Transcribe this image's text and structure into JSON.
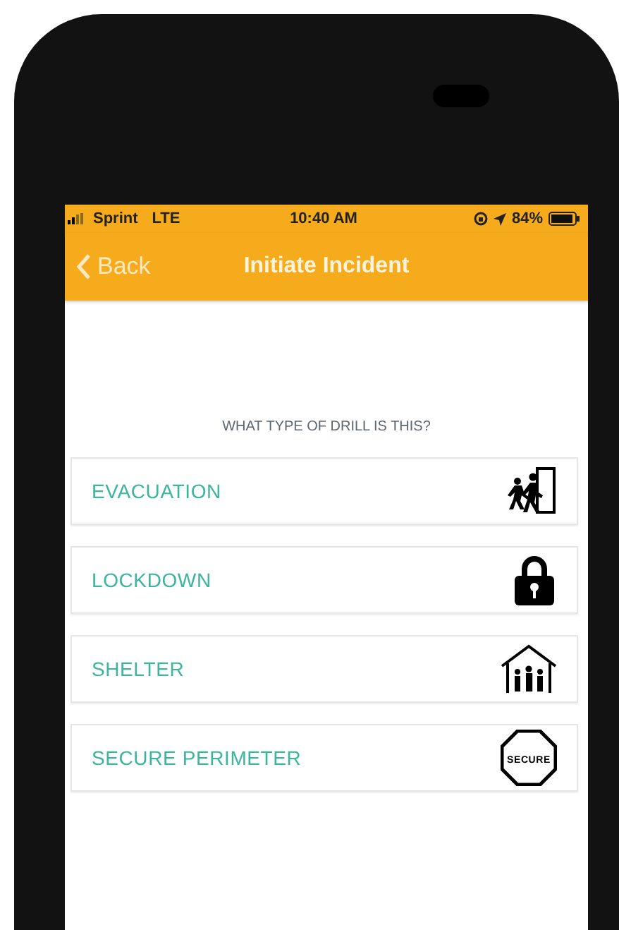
{
  "status_bar": {
    "carrier": "Sprint",
    "network": "LTE",
    "time": "10:40 AM",
    "battery": "84%"
  },
  "nav_bar": {
    "back": "Back",
    "title": "Initiate Incident"
  },
  "question": "WHAT TYPE OF DRILL IS THIS?",
  "options": [
    {
      "label": "EVACUATION",
      "kind": "evacuation"
    },
    {
      "label": "LOCKDOWN",
      "kind": "lockdown"
    },
    {
      "label": "SHELTER",
      "kind": "shelter"
    },
    {
      "label": "SECURE PERIMETER",
      "kind": "secure",
      "icon_text": "SECURE"
    }
  ]
}
